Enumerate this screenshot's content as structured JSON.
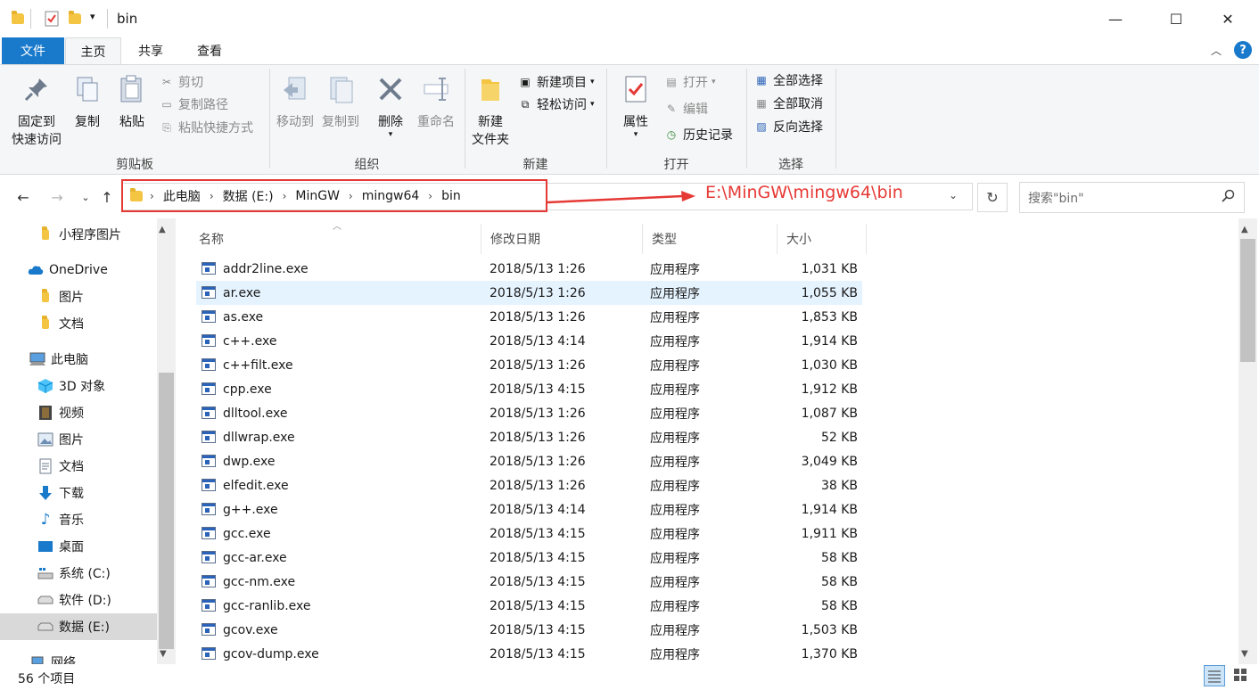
{
  "window": {
    "title": "bin",
    "minimize_glyph": "—",
    "maximize_glyph": "☐",
    "close_glyph": "✕"
  },
  "ribbon_tabs": {
    "file": "文件",
    "home": "主页",
    "share": "共享",
    "view": "查看"
  },
  "ribbon": {
    "clipboard": {
      "label": "剪贴板",
      "pin": "固定到\n快速访问",
      "pin_line1": "固定到",
      "pin_line2": "快速访问",
      "copy": "复制",
      "paste": "粘贴",
      "cut": "剪切",
      "copy_path": "复制路径",
      "paste_shortcut": "粘贴快捷方式"
    },
    "organize": {
      "label": "组织",
      "move_to": "移动到",
      "copy_to": "复制到",
      "delete": "删除",
      "rename": "重命名"
    },
    "new": {
      "label": "新建",
      "new_folder_line1": "新建",
      "new_folder_line2": "文件夹",
      "new_item": "新建项目",
      "easy_access": "轻松访问"
    },
    "open": {
      "label": "打开",
      "properties": "属性",
      "open": "打开",
      "edit": "编辑",
      "history": "历史记录"
    },
    "select": {
      "label": "选择",
      "select_all": "全部选择",
      "select_none": "全部取消",
      "invert": "反向选择"
    }
  },
  "address": {
    "crumbs": [
      "此电脑",
      "数据 (E:)",
      "MinGW",
      "mingw64",
      "bin"
    ],
    "annotation": "E:\\MinGW\\mingw64\\bin",
    "search_placeholder": "搜索\"bin\""
  },
  "nav": {
    "items": [
      {
        "label": "小程序图片",
        "icon": "folder-icon"
      },
      {
        "label": "OneDrive",
        "icon": "cloud-icon"
      },
      {
        "label": "图片",
        "icon": "folder-icon"
      },
      {
        "label": "文档",
        "icon": "folder-icon"
      },
      {
        "label": "此电脑",
        "icon": "computer-icon"
      },
      {
        "label": "3D 对象",
        "icon": "cube-icon"
      },
      {
        "label": "视频",
        "icon": "video-icon"
      },
      {
        "label": "图片",
        "icon": "pictures-icon"
      },
      {
        "label": "文档",
        "icon": "document-icon"
      },
      {
        "label": "下载",
        "icon": "download-icon"
      },
      {
        "label": "音乐",
        "icon": "music-icon"
      },
      {
        "label": "桌面",
        "icon": "desktop-icon"
      },
      {
        "label": "系统 (C:)",
        "icon": "drive-c-icon"
      },
      {
        "label": "软件 (D:)",
        "icon": "drive-icon"
      },
      {
        "label": "数据 (E:)",
        "icon": "drive-icon"
      },
      {
        "label": "网络",
        "icon": "network-icon"
      }
    ]
  },
  "columns": {
    "name": "名称",
    "date": "修改日期",
    "type": "类型",
    "size": "大小"
  },
  "files": [
    {
      "name": "addr2line.exe",
      "date": "2018/5/13 1:26",
      "type": "应用程序",
      "size": "1,031 KB"
    },
    {
      "name": "ar.exe",
      "date": "2018/5/13 1:26",
      "type": "应用程序",
      "size": "1,055 KB"
    },
    {
      "name": "as.exe",
      "date": "2018/5/13 1:26",
      "type": "应用程序",
      "size": "1,853 KB"
    },
    {
      "name": "c++.exe",
      "date": "2018/5/13 4:14",
      "type": "应用程序",
      "size": "1,914 KB"
    },
    {
      "name": "c++filt.exe",
      "date": "2018/5/13 1:26",
      "type": "应用程序",
      "size": "1,030 KB"
    },
    {
      "name": "cpp.exe",
      "date": "2018/5/13 4:15",
      "type": "应用程序",
      "size": "1,912 KB"
    },
    {
      "name": "dlltool.exe",
      "date": "2018/5/13 1:26",
      "type": "应用程序",
      "size": "1,087 KB"
    },
    {
      "name": "dllwrap.exe",
      "date": "2018/5/13 1:26",
      "type": "应用程序",
      "size": "52 KB"
    },
    {
      "name": "dwp.exe",
      "date": "2018/5/13 1:26",
      "type": "应用程序",
      "size": "3,049 KB"
    },
    {
      "name": "elfedit.exe",
      "date": "2018/5/13 1:26",
      "type": "应用程序",
      "size": "38 KB"
    },
    {
      "name": "g++.exe",
      "date": "2018/5/13 4:14",
      "type": "应用程序",
      "size": "1,914 KB"
    },
    {
      "name": "gcc.exe",
      "date": "2018/5/13 4:15",
      "type": "应用程序",
      "size": "1,911 KB"
    },
    {
      "name": "gcc-ar.exe",
      "date": "2018/5/13 4:15",
      "type": "应用程序",
      "size": "58 KB"
    },
    {
      "name": "gcc-nm.exe",
      "date": "2018/5/13 4:15",
      "type": "应用程序",
      "size": "58 KB"
    },
    {
      "name": "gcc-ranlib.exe",
      "date": "2018/5/13 4:15",
      "type": "应用程序",
      "size": "58 KB"
    },
    {
      "name": "gcov.exe",
      "date": "2018/5/13 4:15",
      "type": "应用程序",
      "size": "1,503 KB"
    },
    {
      "name": "gcov-dump.exe",
      "date": "2018/5/13 4:15",
      "type": "应用程序",
      "size": "1,370 KB"
    }
  ],
  "status": {
    "count": "56 个项目"
  },
  "colors": {
    "accent": "#1979ca",
    "annotation": "#e53935",
    "hover_row": "#e5f3ff"
  }
}
